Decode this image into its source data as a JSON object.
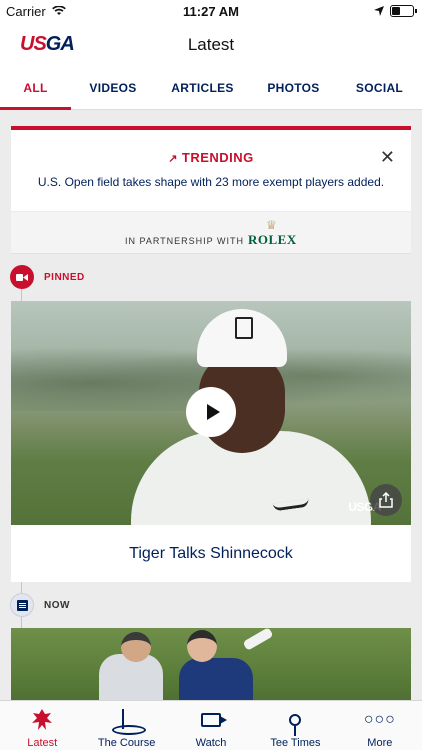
{
  "status_bar": {
    "carrier": "Carrier",
    "time": "11:27 AM"
  },
  "header": {
    "logo_us": "US",
    "logo_ga": "GA",
    "title": "Latest"
  },
  "tabs": [
    {
      "label": "ALL",
      "active": true
    },
    {
      "label": "VIDEOS"
    },
    {
      "label": "ARTICLES"
    },
    {
      "label": "PHOTOS"
    },
    {
      "label": "SOCIAL"
    }
  ],
  "trending": {
    "heading": "TRENDING",
    "text": "U.S. Open field takes shape with 23 more exempt players added."
  },
  "partnership": {
    "text": "IN PARTNERSHIP WITH",
    "brand": "ROLEX"
  },
  "feed": {
    "pinned_label": "PINNED",
    "pinned_card": {
      "title": "Tiger Talks Shinnecock",
      "watermark": "USGA"
    },
    "now_label": "NOW"
  },
  "tab_bar": [
    {
      "label": "Latest",
      "icon": "eagle-logo-icon",
      "active": true
    },
    {
      "label": "The Course",
      "icon": "flag-icon"
    },
    {
      "label": "Watch",
      "icon": "video-camera-icon"
    },
    {
      "label": "Tee Times",
      "icon": "golf-tee-icon"
    },
    {
      "label": "More",
      "icon": "more-dots-icon"
    }
  ],
  "colors": {
    "brand_red": "#c8102e",
    "brand_navy": "#00205b",
    "rolex_green": "#006039"
  }
}
